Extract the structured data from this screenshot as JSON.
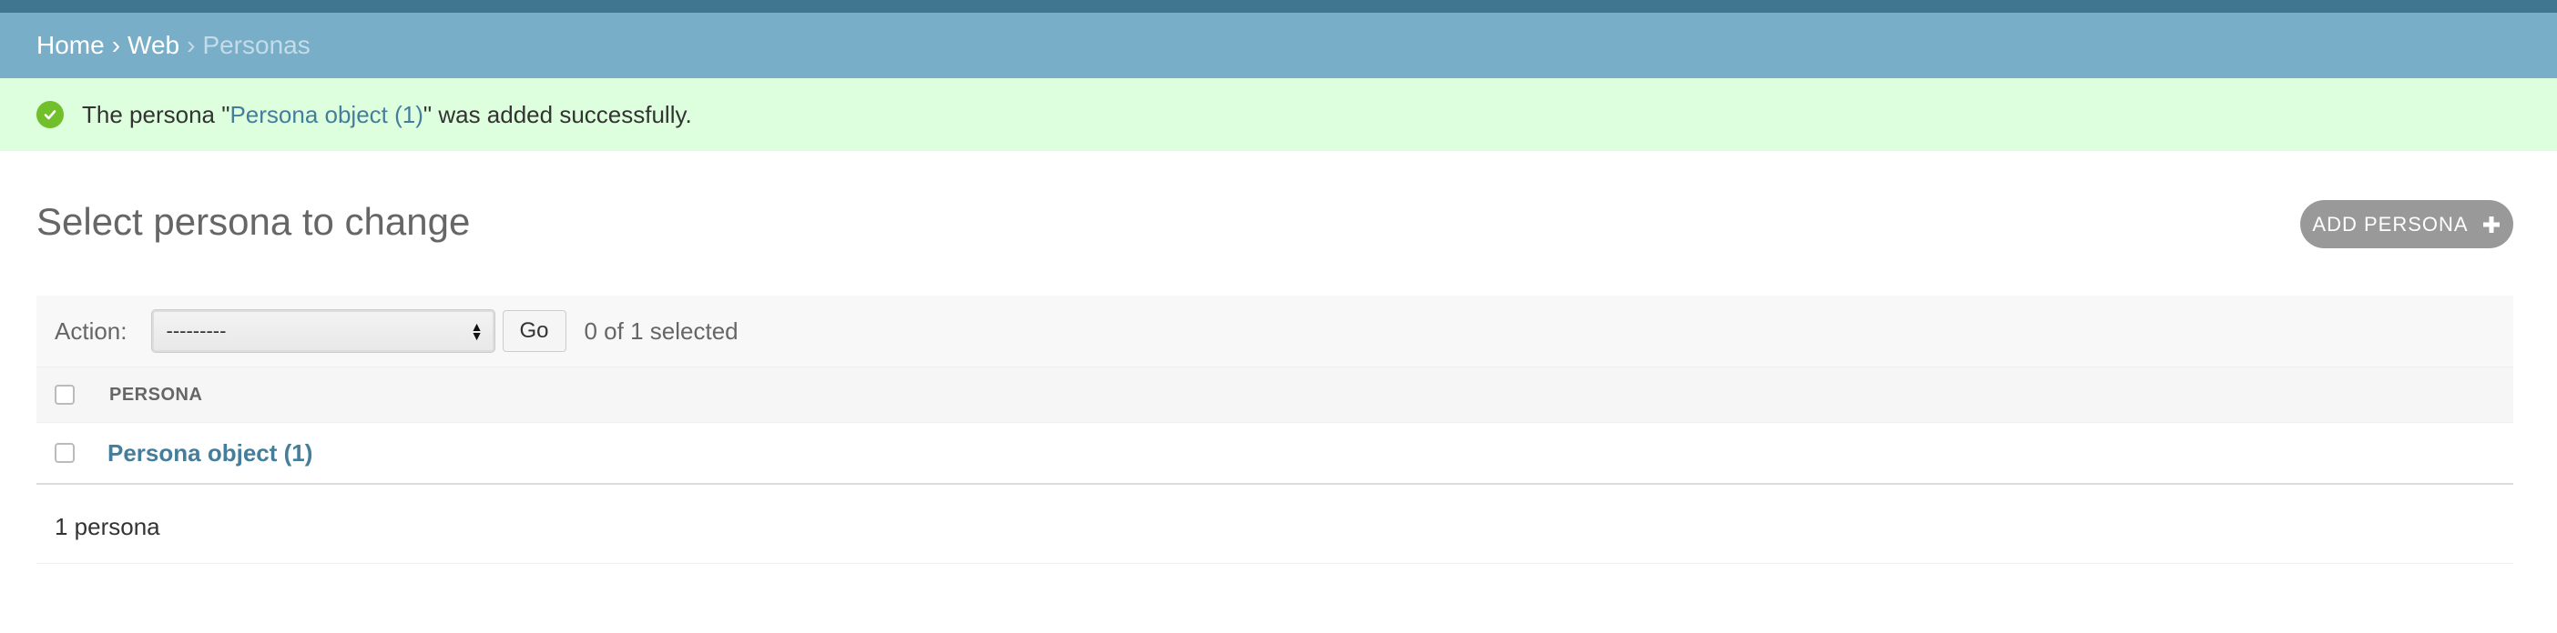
{
  "breadcrumbs": {
    "home": "Home",
    "separator": "›",
    "app": "Web",
    "current": "Personas"
  },
  "message": {
    "prefix": "The persona \"",
    "link_text": "Persona object (1)",
    "suffix": "\" was added successfully.",
    "icon": "check-circle-icon"
  },
  "page_title": "Select persona to change",
  "add_button": {
    "label": "ADD PERSONA",
    "icon": "plus-icon"
  },
  "actions": {
    "label": "Action:",
    "selected_value": "---------",
    "go_label": "Go",
    "selected_count": "0 of 1 selected"
  },
  "table": {
    "columns": [
      "PERSONA"
    ],
    "rows": [
      {
        "label": "Persona object (1)",
        "selected": false
      }
    ]
  },
  "paginator": {
    "text": "1 persona"
  },
  "colors": {
    "header_dark": "#417690",
    "breadcrumb_bar": "#79aec8",
    "success_bg": "#ddffdd",
    "success_icon": "#70bf2b",
    "link": "#447e9b",
    "add_button_bg": "#999999"
  }
}
